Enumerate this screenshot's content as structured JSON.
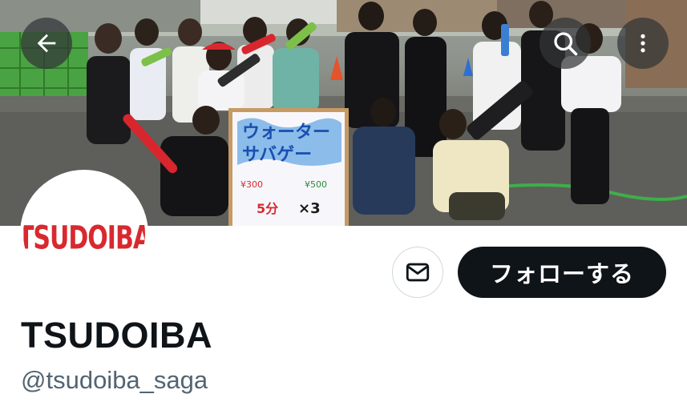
{
  "profile": {
    "display_name": "TSUDOIBA",
    "handle": "@tsudoiba_saga",
    "avatar_logo_text": "TSUDOIBA"
  },
  "actions": {
    "follow_label": "フォローする",
    "message_icon": "envelope-icon"
  },
  "header": {
    "back_icon": "arrow-left-icon",
    "search_icon": "search-icon",
    "more_icon": "more-vertical-icon"
  },
  "banner": {
    "sign_title_line1": "ウォーター",
    "sign_title_line2": "サバゲー",
    "sign_price_1": "¥300",
    "sign_price_2": "¥500",
    "sign_bottom_left": "5分",
    "sign_bottom_right": "×3"
  },
  "colors": {
    "accent_red": "#d8292f",
    "follow_bg": "#0f1419",
    "handle_gray": "#536471"
  }
}
